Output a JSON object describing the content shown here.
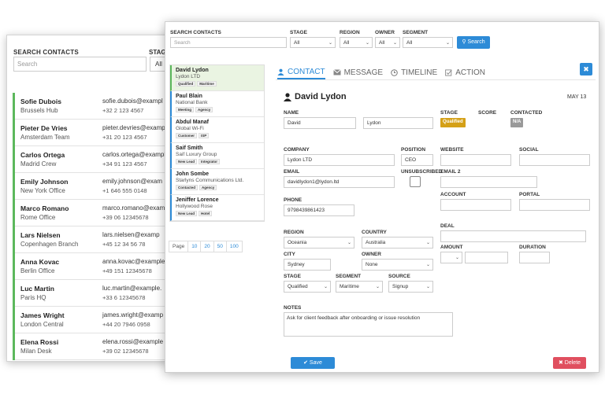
{
  "back": {
    "search_label": "SEARCH CONTACTS",
    "search_placeholder": "Search",
    "stage_label": "STAG",
    "select_value": "All",
    "rows": [
      {
        "name": "Sofie Dubois",
        "team": "Brussels Hub",
        "email": "sofie.dubois@exampl",
        "phone": "+32 2 123 4567"
      },
      {
        "name": "Pieter De Vries",
        "team": "Amsterdam Team",
        "email": "pieter.devries@examp",
        "phone": "+31 20 123 4567"
      },
      {
        "name": "Carlos Ortega",
        "team": "Madrid Crew",
        "email": "carlos.ortega@exampl",
        "phone": "+34 91 123 4567"
      },
      {
        "name": "Emily Johnson",
        "team": "New York Office",
        "email": "emily.johnson@exam",
        "phone": "+1 646 555 0148"
      },
      {
        "name": "Marco Romano",
        "team": "Rome Office",
        "email": "marco.romano@exam",
        "phone": "+39 06 12345678"
      },
      {
        "name": "Lars Nielsen",
        "team": "Copenhagen Branch",
        "email": "lars.nielsen@examp",
        "phone": "+45 12 34 56 78"
      },
      {
        "name": "Anna Kovac",
        "team": "Berlin Office",
        "email": "anna.kovac@example",
        "phone": "+49 151 12345678"
      },
      {
        "name": "Luc Martin",
        "team": "Paris HQ",
        "email": "luc.martin@example.",
        "phone": "+33 6 12345678"
      },
      {
        "name": "James Wright",
        "team": "London Central",
        "email": "james.wright@examp",
        "phone": "+44 20 7946 0958"
      },
      {
        "name": "Elena Rossi",
        "team": "Milan Desk",
        "email": "elena.rossi@example",
        "phone": "+39 02 12345678"
      }
    ]
  },
  "filters": {
    "search_label": "SEARCH CONTACTS",
    "search_placeholder": "Search",
    "stage_label": "STAGE",
    "region_label": "REGION",
    "owner_label": "OWNER",
    "segment_label": "SEGMENT",
    "stage_value": "All",
    "region_value": "All",
    "owner_value": "All",
    "segment_value": "All",
    "search_button": "Search"
  },
  "contacts": [
    {
      "name": "David Lydon",
      "org": "Lydon LTD",
      "tags": [
        "Qualified",
        "Maritime"
      ]
    },
    {
      "name": "Paul Blain",
      "org": "National Bank",
      "tags": [
        "Meeting",
        "Agency"
      ]
    },
    {
      "name": "Abdul Manaf",
      "org": "Global Wi-Fi",
      "tags": [
        "Customer",
        "ISP"
      ]
    },
    {
      "name": "Saif Smith",
      "org": "Saif Luxury Group",
      "tags": [
        "New Lead",
        "Integrator"
      ]
    },
    {
      "name": "John Sombe",
      "org": "Starlyns Communications Ltd.",
      "tags": [
        "Contacted",
        "Agency"
      ]
    },
    {
      "name": "Jeniffer Lorence",
      "org": "Hollywood Rose",
      "tags": [
        "New Lead",
        "Hotel"
      ]
    }
  ],
  "pager": {
    "label": "Page",
    "options": [
      "10",
      "20",
      "50",
      "100"
    ]
  },
  "tabs": [
    "CONTACT",
    "MESSAGE",
    "TIMELINE",
    "ACTION"
  ],
  "close_label": "✖",
  "form": {
    "title": "David Lydon",
    "date": "MAY 13",
    "name_label": "NAME",
    "first_name": "David",
    "last_name": "Lydon",
    "stage_label": "STAGE",
    "stage_badge": "Qualified",
    "score_label": "SCORE",
    "contacted_label": "CONTACTED",
    "contacted_badge": "N/A",
    "company_label": "COMPANY",
    "company": "Lydon LTD",
    "position_label": "POSITION",
    "position": "CEO",
    "website_label": "WEBSITE",
    "social_label": "SOCIAL",
    "email_label": "EMAIL",
    "email": "davidlydon1@lydon.ltd",
    "unsubscribed_label": "UNSUBSCRIBED",
    "email2_label": "EMAIL 2",
    "account_label": "ACCOUNT",
    "portal_label": "PORTAL",
    "phone_label": "PHONE",
    "phone": "9798439861423",
    "deal_label": "DEAL",
    "amount_label": "AMOUNT",
    "duration_label": "DURATION",
    "region_label": "REGION",
    "region": "Oceania",
    "country_label": "COUNTRY",
    "country": "Australia",
    "city_label": "CITY",
    "city": "Sydney",
    "owner_label": "OWNER",
    "owner": "None",
    "stage2_label": "STAGE",
    "stage2": "Qualified",
    "segment_label": "SEGMENT",
    "segment": "Maritime",
    "source_label": "SOURCE",
    "source": "Signup",
    "notes_label": "NOTES",
    "notes": "Ask for client feedback after onboarding or issue resolution",
    "save": "Save",
    "delete": "Delete"
  },
  "colors": {
    "accent": "#2d8bd7",
    "success": "#5cb85c",
    "stage_badge": "#d4a017",
    "danger": "#e04f5f"
  }
}
